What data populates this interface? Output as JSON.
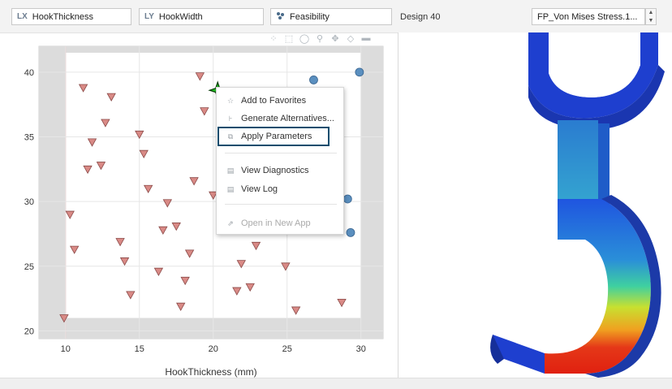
{
  "toolbar": {
    "x_param": {
      "prefix": "LX",
      "label": "HookThickness"
    },
    "y_param": {
      "prefix": "LY",
      "label": "HookWidth"
    },
    "color_param": {
      "label": "Feasibility"
    },
    "design_label": "Design 40",
    "result_select": "FP_Von Mises Stress.1...",
    "stepper_up": "▲",
    "stepper_down": "▼"
  },
  "plot_tools": [
    "lasso-select-icon",
    "box-select-icon",
    "comment-icon",
    "zoom-icon",
    "pan-icon",
    "fit-icon",
    "toggle-icon"
  ],
  "context_menu": {
    "items": [
      {
        "label": "Add to Favorites",
        "icon": "star-icon",
        "enabled": true
      },
      {
        "label": "Generate Alternatives...",
        "icon": "generate-icon",
        "enabled": true
      },
      {
        "label": "Apply Parameters",
        "icon": "apply-icon",
        "enabled": true
      },
      {
        "label": "View Diagnostics",
        "icon": "document-icon",
        "enabled": true
      },
      {
        "label": "View Log",
        "icon": "document-icon",
        "enabled": true
      },
      {
        "label": "Open in New App",
        "icon": "external-link-icon",
        "enabled": false
      }
    ],
    "highlighted": "Apply Parameters"
  },
  "chart_data": {
    "type": "scatter",
    "xlabel": "HookThickness (mm)",
    "ylabel": "",
    "xlim": [
      8.2,
      31.5
    ],
    "ylim": [
      19.4,
      42
    ],
    "xticks": [
      10,
      15,
      20,
      25,
      30
    ],
    "yticks": [
      20,
      25,
      30,
      35,
      40
    ],
    "grid": true,
    "infeasible_band": {
      "x_min": 10,
      "x_max": 30,
      "y_min": 21,
      "y_max": 41.5,
      "color": "#dcdcdc"
    },
    "series": [
      {
        "marker": "triangle-down",
        "color": "#d98a86",
        "x": [
          9.9,
          10.3,
          10.6,
          11.2,
          11.5,
          11.8,
          12.4,
          12.7,
          13.1,
          13.7,
          14.0,
          14.4,
          15.0,
          15.3,
          15.6,
          16.3,
          16.6,
          16.9,
          17.5,
          17.8,
          18.1,
          18.4,
          18.7,
          19.1,
          19.4,
          20.0,
          21.6,
          21.9,
          22.5,
          22.9,
          24.9,
          25.6,
          28.7
        ],
        "y": [
          21.0,
          29.0,
          26.3,
          38.8,
          32.5,
          34.6,
          32.8,
          36.1,
          38.1,
          26.9,
          25.4,
          22.8,
          35.2,
          33.7,
          31.0,
          24.6,
          27.8,
          29.9,
          28.1,
          21.9,
          23.9,
          26.0,
          31.6,
          39.7,
          37.0,
          30.5,
          23.1,
          25.2,
          23.4,
          26.6,
          25.0,
          21.6,
          22.2
        ]
      },
      {
        "marker": "circle",
        "color": "#5a8fbf",
        "x": [
          26.8,
          29.9,
          29.1,
          29.3
        ],
        "y": [
          39.4,
          40.0,
          30.2,
          27.6
        ]
      },
      {
        "marker": "star",
        "color": "#22c022",
        "x": [
          20.3
        ],
        "y": [
          38.6
        ]
      }
    ]
  }
}
